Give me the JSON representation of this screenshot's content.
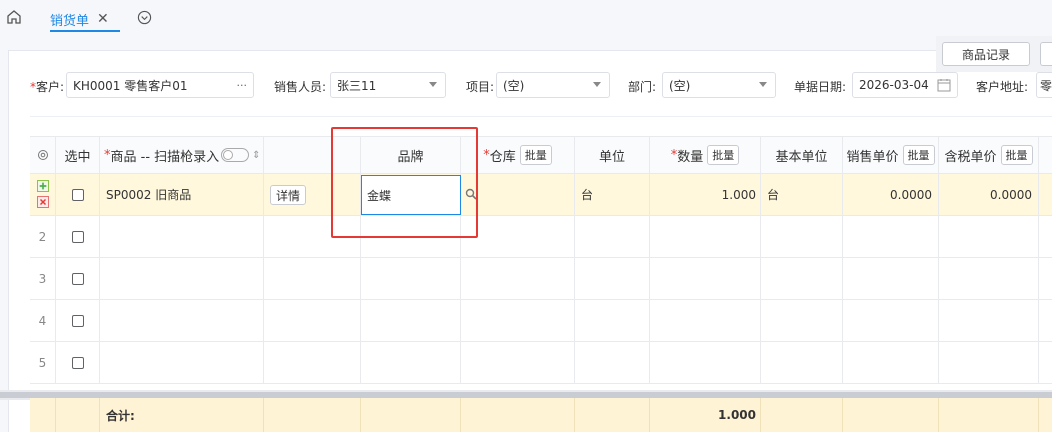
{
  "tabs": [
    {
      "label": "销货单",
      "close": "✕"
    }
  ],
  "toolbar": {
    "product_record": "商品记录"
  },
  "form": {
    "customer_label": "客户:",
    "customer_value": "KH0001 零售客户01",
    "customer_suffix": "···",
    "salesperson_label": "销售人员:",
    "salesperson_value": "张三11",
    "project_label": "项目:",
    "project_value": "(空)",
    "dept_label": "部门:",
    "dept_value": "(空)",
    "date_label": "单据日期:",
    "date_value": "2026-03-04",
    "address_label": "客户地址:",
    "address_value": "零"
  },
  "grid": {
    "headers": {
      "select": "选中",
      "product": "商品 -- 扫描枪录入",
      "sort": "⇕",
      "brand": "品牌",
      "warehouse": "仓库",
      "batch": "批量",
      "unit": "单位",
      "qty": "数量",
      "base_unit": "基本单位",
      "price": "销售单价",
      "tax_price": "含税单价"
    },
    "rows": [
      {
        "num": "",
        "product": "SP0002 旧商品",
        "detail": "详情",
        "brand": "金蝶",
        "unit": "台",
        "qty": "1.000",
        "base_unit": "台",
        "price": "0.0000",
        "tax_price": "0.0000"
      },
      {
        "num": "2"
      },
      {
        "num": "3"
      },
      {
        "num": "4"
      },
      {
        "num": "5"
      }
    ],
    "total_label": "合计:",
    "total_qty": "1.000"
  }
}
